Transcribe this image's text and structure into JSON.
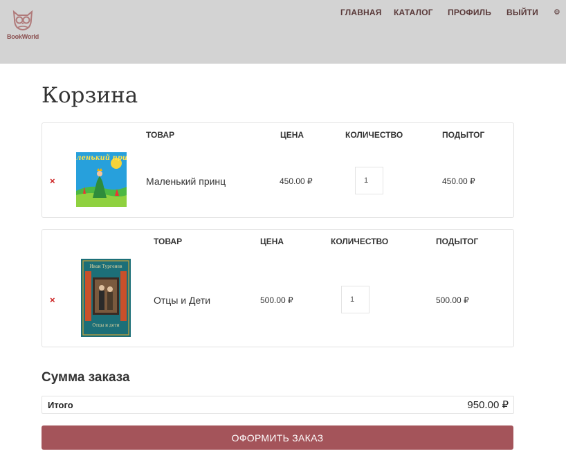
{
  "header": {
    "logo_text": "BookWorld",
    "nav": [
      "ГЛАВНАЯ",
      "КАТАЛОГ",
      "ПРОФИЛЬ",
      "ВЫЙТИ"
    ],
    "settings_icon": "gear-icon"
  },
  "page": {
    "title": "Корзина"
  },
  "columns": {
    "product": "ТОВАР",
    "price": "ЦЕНА",
    "quantity": "КОЛИЧЕСТВО",
    "subtotal": "ПОДЫТОГ"
  },
  "cart_items": [
    {
      "remove": "×",
      "name": "Маленький принц",
      "cover_title": "Маленький принц",
      "price": "450.00 ₽",
      "quantity": "1",
      "subtotal": "450.00 ₽"
    },
    {
      "remove": "×",
      "name": "Отцы и Дети",
      "cover_author": "Иван Тургенев",
      "cover_title": "Отцы и дети",
      "price": "500.00 ₽",
      "quantity": "1",
      "subtotal": "500.00 ₽"
    }
  ],
  "summary": {
    "title": "Сумма заказа",
    "total_label": "Итого",
    "total_value": "950.00 ₽"
  },
  "checkout_label": "ОФОРМИТЬ ЗАКАЗ",
  "colors": {
    "header_bg": "#d3d3d3",
    "accent": "#a4545a",
    "remove": "#cc1f1f"
  }
}
